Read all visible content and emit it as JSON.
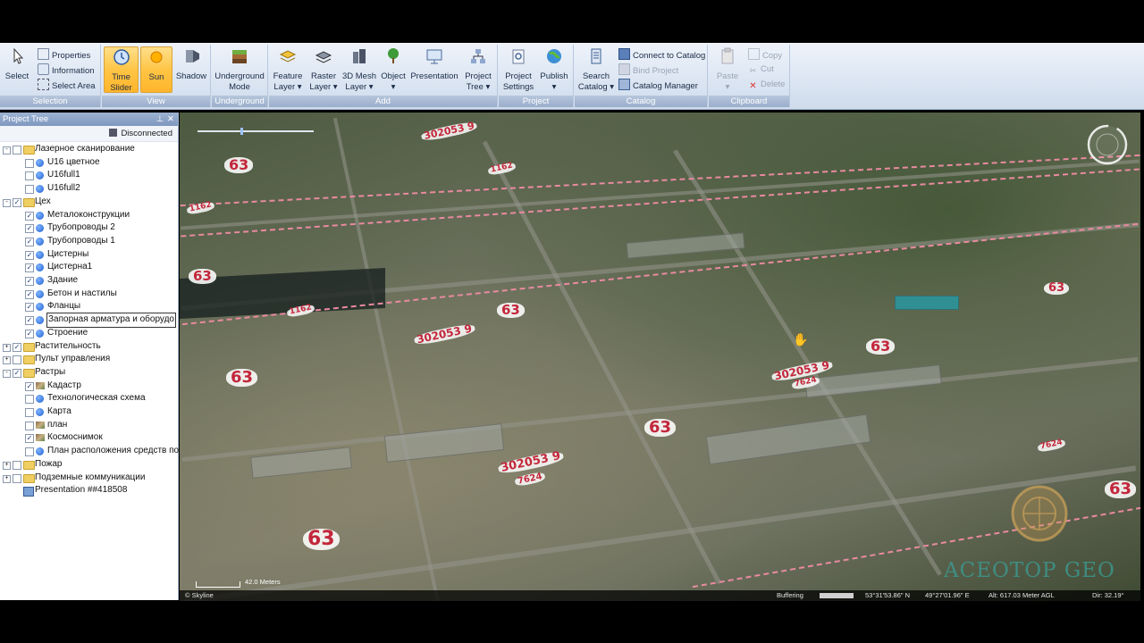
{
  "ribbon": {
    "selection": {
      "label": "Selection",
      "select": "Select",
      "properties": "Properties",
      "information": "Information",
      "select_area": "Select Area"
    },
    "view": {
      "label": "View",
      "time_slider_1": "Time",
      "time_slider_2": "Slider",
      "sun": "Sun",
      "shadow": "Shadow"
    },
    "underground": {
      "label": "Underground",
      "mode_1": "Underground",
      "mode_2": "Mode"
    },
    "add": {
      "label": "Add",
      "feature_1": "Feature",
      "feature_2": "Layer",
      "raster_1": "Raster",
      "raster_2": "Layer",
      "mesh_1": "3D Mesh",
      "mesh_2": "Layer",
      "object": "Object",
      "presentation": "Presentation",
      "project_tree_1": "Project",
      "project_tree_2": "Tree"
    },
    "project": {
      "label": "Project",
      "settings_1": "Project",
      "settings_2": "Settings",
      "publish": "Publish"
    },
    "catalog": {
      "label": "Catalog",
      "search_1": "Search",
      "search_2": "Catalog",
      "connect": "Connect to Catalog",
      "bind": "Bind Project",
      "manager": "Catalog Manager"
    },
    "clipboard": {
      "label": "Clipboard",
      "paste": "Paste",
      "copy": "Copy",
      "cut": "Cut",
      "delete": "Delete"
    }
  },
  "panel": {
    "title": "Project Tree",
    "status": "Disconnected",
    "items": [
      {
        "label": "Лазерное сканирование",
        "level": 0,
        "type": "folder",
        "checked": false,
        "expander": "-"
      },
      {
        "label": "U16 цветное",
        "level": 1,
        "type": "layer",
        "checked": false
      },
      {
        "label": "U16full1",
        "level": 1,
        "type": "layer",
        "checked": false
      },
      {
        "label": "U16full2",
        "level": 1,
        "type": "layer",
        "checked": false
      },
      {
        "label": "Цех",
        "level": 0,
        "type": "folder",
        "checked": true,
        "expander": "-"
      },
      {
        "label": "Металоконструкции",
        "level": 1,
        "type": "layer",
        "checked": true
      },
      {
        "label": "Трубопроводы 2",
        "level": 1,
        "type": "layer",
        "checked": true
      },
      {
        "label": "Трубопроводы 1",
        "level": 1,
        "type": "layer",
        "checked": true
      },
      {
        "label": "Цистерны",
        "level": 1,
        "type": "layer",
        "checked": true
      },
      {
        "label": "Цистерна1",
        "level": 1,
        "type": "layer",
        "checked": true
      },
      {
        "label": "Здание",
        "level": 1,
        "type": "layer",
        "checked": true
      },
      {
        "label": "Бетон и настилы",
        "level": 1,
        "type": "layer",
        "checked": true
      },
      {
        "label": "Фланцы",
        "level": 1,
        "type": "layer",
        "checked": true
      },
      {
        "label": "Запорная арматура и оборудо",
        "level": 1,
        "type": "layer",
        "checked": true,
        "selected": true
      },
      {
        "label": "Строение",
        "level": 1,
        "type": "layer",
        "checked": true
      },
      {
        "label": "Растительность",
        "level": 0,
        "type": "folder",
        "checked": true,
        "expander": "+"
      },
      {
        "label": "Пульт управления",
        "level": 0,
        "type": "folder",
        "checked": false,
        "expander": "+"
      },
      {
        "label": "Растры",
        "level": 0,
        "type": "folder",
        "checked": true,
        "expander": "-"
      },
      {
        "label": "Кадастр",
        "level": 1,
        "type": "raster",
        "checked": true
      },
      {
        "label": "Технологическая схема",
        "level": 1,
        "type": "layer",
        "checked": false
      },
      {
        "label": "Карта",
        "level": 1,
        "type": "layer",
        "checked": false
      },
      {
        "label": "план",
        "level": 1,
        "type": "raster",
        "checked": false
      },
      {
        "label": "Космоснимок",
        "level": 1,
        "type": "raster",
        "checked": true
      },
      {
        "label": "План расположения средств по",
        "level": 1,
        "type": "layer",
        "checked": false
      },
      {
        "label": "Пожар",
        "level": 0,
        "type": "folder",
        "checked": false,
        "expander": "+"
      },
      {
        "label": "Подземные коммуникации",
        "level": 0,
        "type": "folder",
        "checked": false,
        "expander": "+"
      },
      {
        "label": "Presentation ##418508",
        "level": 0,
        "type": "presentation",
        "checked": null
      }
    ]
  },
  "map": {
    "scale_text": "42.0 Meters",
    "brand": "© Skyline",
    "buffering": "Buffering",
    "lat": "53°31'53.86\" N",
    "lon": "49°27'01.96\" E",
    "alt": "Alt: 617.03 Meter AGL",
    "dir": "Dir: 32.19°",
    "labels": {
      "l63": "63",
      "lot": "302053 9",
      "small": "7624",
      "tag": "1162"
    },
    "logo": "ACEOTOP GEO"
  },
  "colors": {
    "accent": "#ffc546",
    "label": "#c3273b",
    "panel_header": "#7f98bf"
  }
}
